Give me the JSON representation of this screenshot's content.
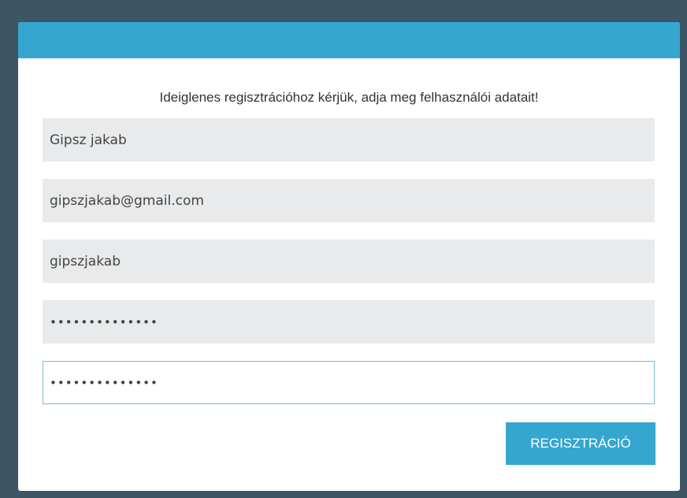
{
  "form": {
    "intro_text": "Ideiglenes regisztrációhoz kérjük, adja meg felhasználói adatait!",
    "fields": {
      "full_name": {
        "value": "Gipsz jakab"
      },
      "email": {
        "value": "gipszjakab@gmail.com"
      },
      "username": {
        "value": "gipszjakab"
      },
      "password": {
        "value": "••••••••••••••"
      },
      "password_confirm": {
        "value": "••••••••••••••"
      }
    },
    "submit_label": "REGISZTRÁCIÓ",
    "focused_field": "password_confirm"
  },
  "colors": {
    "header": "#35a6cf",
    "background": "#3b5565",
    "field_fill": "#e8eaec",
    "focus_border": "#7fb9d2",
    "button": "#35a6cf"
  }
}
